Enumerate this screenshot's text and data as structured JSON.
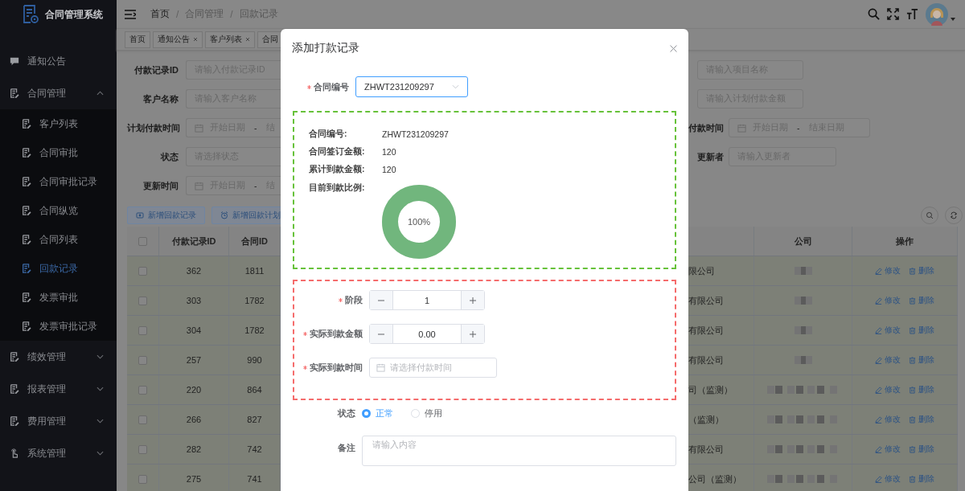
{
  "sidebar": {
    "app_title": "合同管理系统",
    "items": [
      {
        "label": "通知公告"
      },
      {
        "label": "合同管理",
        "expanded": true,
        "children": [
          {
            "label": "客户列表",
            "selected": false
          },
          {
            "label": "合同审批",
            "selected": false
          },
          {
            "label": "合同审批记录",
            "selected": false
          },
          {
            "label": "合同纵览",
            "selected": false
          },
          {
            "label": "合同列表",
            "selected": false
          },
          {
            "label": "回款记录",
            "selected": true
          },
          {
            "label": "发票审批",
            "selected": false
          },
          {
            "label": "发票审批记录",
            "selected": false
          }
        ]
      },
      {
        "label": "绩效管理",
        "expanded": false
      },
      {
        "label": "报表管理",
        "expanded": false
      },
      {
        "label": "费用管理",
        "expanded": false
      },
      {
        "label": "系统管理",
        "expanded": false
      }
    ]
  },
  "header": {
    "breadcrumb": [
      "首页",
      "合同管理",
      "回款记录"
    ],
    "separator": "/"
  },
  "tags": [
    {
      "label": "首页",
      "closable": false
    },
    {
      "label": "通知公告",
      "closable": true
    },
    {
      "label": "客户列表",
      "closable": true
    },
    {
      "label": "合同",
      "closable": false
    }
  ],
  "filters": {
    "left": [
      {
        "label": "付款记录ID",
        "kind": "text",
        "placeholder": "请输入付款记录ID"
      },
      {
        "label": "客户名称",
        "kind": "text",
        "placeholder": "请输入客户名称"
      },
      {
        "label": "计划付款时间",
        "kind": "daterange",
        "start_placeholder": "开始日期",
        "separator": "-",
        "end_placeholder": "结"
      },
      {
        "label": "状态",
        "kind": "select",
        "placeholder": "请选择状态"
      },
      {
        "label": "更新时间",
        "kind": "daterange",
        "start_placeholder": "开始日期",
        "separator": "-",
        "end_placeholder": "结"
      }
    ],
    "right": [
      {
        "kind": "text",
        "placeholder": "请输入项目名称"
      },
      {
        "kind": "text",
        "placeholder": "请输入计划付款金额"
      },
      {
        "label": "付款时间",
        "kind": "daterange",
        "start_placeholder": "开始日期",
        "separator": "-",
        "end_placeholder": "结束日期"
      },
      {
        "label": "更新者",
        "kind": "text",
        "placeholder": "请输入更新者"
      }
    ]
  },
  "toolbar": {
    "buttons": [
      "新增回款记录",
      "新增回款计划"
    ]
  },
  "table": {
    "all_checked": false,
    "columns": [
      "付款记录ID",
      "合同ID",
      "公司",
      "操作"
    ],
    "rows": [
      {
        "checked": false,
        "payment_id": "362",
        "contract_id": "1811",
        "column_4": "限公司",
        "actions": [
          "修改",
          "删除"
        ]
      },
      {
        "checked": false,
        "payment_id": "303",
        "contract_id": "1782",
        "column_4": "有限公司",
        "actions": [
          "修改",
          "删除"
        ]
      },
      {
        "checked": false,
        "payment_id": "304",
        "contract_id": "1782",
        "column_4": "有限公司",
        "actions": [
          "修改",
          "删除"
        ]
      },
      {
        "checked": false,
        "payment_id": "257",
        "contract_id": "990",
        "column_4": "有限公司",
        "actions": [
          "修改",
          "删除"
        ]
      },
      {
        "checked": false,
        "payment_id": "220",
        "contract_id": "864",
        "column_4": "司（监测）",
        "actions": [
          "修改",
          "删除"
        ]
      },
      {
        "checked": false,
        "payment_id": "266",
        "contract_id": "827",
        "column_4": "（监测）",
        "actions": [
          "修改",
          "删除"
        ]
      },
      {
        "checked": false,
        "payment_id": "282",
        "contract_id": "742",
        "column_4": "有限公司",
        "actions": [
          "修改",
          "删除"
        ]
      },
      {
        "checked": false,
        "payment_id": "275",
        "contract_id": "741",
        "column_4": "公司（监测）",
        "actions": [
          "修改",
          "删除"
        ]
      }
    ]
  },
  "modal": {
    "title": "添加打款记录",
    "contract_field": {
      "label": "合同编号",
      "required": true,
      "value": "ZHWT231209297"
    },
    "summary": {
      "rows": [
        {
          "label": "合同编号:",
          "value": "ZHWT231209297"
        },
        {
          "label": "合同签订金额:",
          "value": "120"
        },
        {
          "label": "累计到款金额:",
          "value": "120"
        }
      ],
      "ratio_label": "目前到款比例:",
      "ratio": {
        "level": 1,
        "reading": "100%"
      }
    },
    "payment_fields": [
      {
        "label": "阶段",
        "required": true,
        "kind": "stepper",
        "value": "1"
      },
      {
        "label": "实际到款金额",
        "required": true,
        "kind": "stepper",
        "value": "0.00"
      },
      {
        "label": "实际到款时间",
        "required": true,
        "kind": "date",
        "placeholder": "请选择付款时间"
      }
    ],
    "status": {
      "label": "状态",
      "options": [
        {
          "label": "正常",
          "selected": true
        },
        {
          "label": "停用",
          "selected": false
        }
      ]
    },
    "remark": {
      "label": "备注",
      "placeholder": "请输入内容"
    }
  }
}
